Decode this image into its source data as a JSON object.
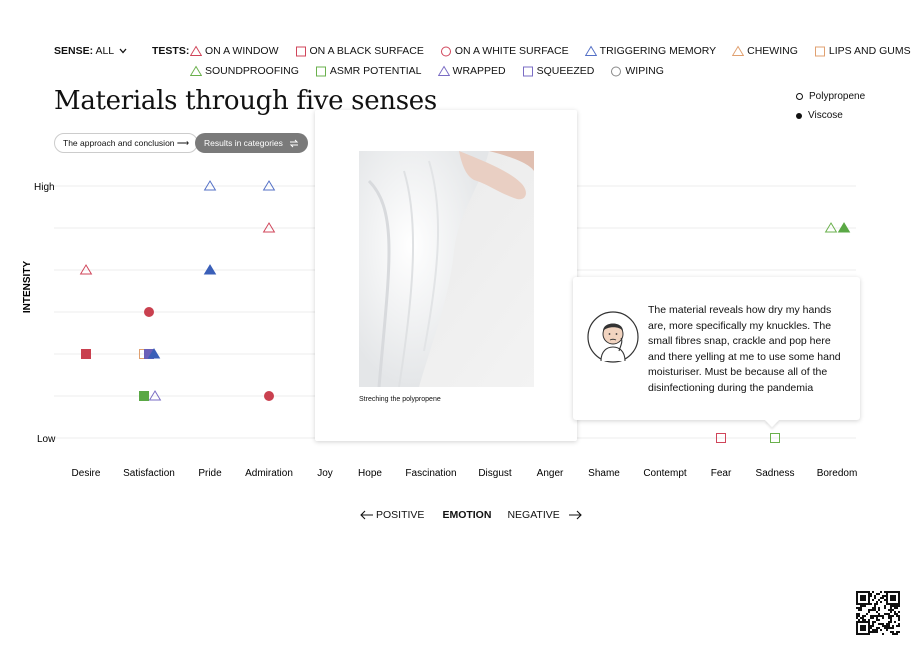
{
  "filters": {
    "sense_label": "SENSE:",
    "sense_value": "ALL",
    "tests_label": "TESTS:",
    "tests_row1": [
      {
        "label": "ON A WINDOW",
        "shape": "triangle",
        "color": "#d0455a"
      },
      {
        "label": "ON A BLACK SURFACE",
        "shape": "square",
        "color": "#d0455a"
      },
      {
        "label": "ON A WHITE SURFACE",
        "shape": "circle",
        "color": "#d0455a"
      },
      {
        "label": "TRIGGERING MEMORY",
        "shape": "triangle",
        "color": "#5470c6"
      },
      {
        "label": "CHEWING",
        "shape": "triangle",
        "color": "#e0a070"
      },
      {
        "label": "LIPS AND GUMS",
        "shape": "square",
        "color": "#e0a070"
      }
    ],
    "tests_row2": [
      {
        "label": "SOUNDPROOFING",
        "shape": "triangle",
        "color": "#6ab04c"
      },
      {
        "label": "ASMR POTENTIAL",
        "shape": "square",
        "color": "#6ab04c"
      },
      {
        "label": "WRAPPED",
        "shape": "triangle",
        "color": "#7a6cc4"
      },
      {
        "label": "SQUEEZED",
        "shape": "square",
        "color": "#7a6cc4"
      },
      {
        "label": "WIPING",
        "shape": "circle",
        "color": "#888888"
      }
    ]
  },
  "title": "Materials through five senses",
  "buttons": {
    "approach": "The approach and conclusion ⟶",
    "results": "Results in categories"
  },
  "materials": [
    {
      "label": "Polypropene",
      "filled": false
    },
    {
      "label": "Viscose",
      "filled": true
    }
  ],
  "chart_data": {
    "type": "scatter",
    "ylabel": "INTENSITY",
    "y_ticks": [
      "High",
      "Low"
    ],
    "categories": [
      "Desire",
      "Satisfaction",
      "Pride",
      "Admiration",
      "Joy",
      "Hope",
      "Fascination",
      "Disgust",
      "Anger",
      "Shame",
      "Contempt",
      "Fear",
      "Sadness",
      "Boredom"
    ],
    "levels": 7,
    "points": [
      {
        "cat": "Pride",
        "level": 7,
        "shape": "triangle",
        "color": "#5470c6",
        "filled": false
      },
      {
        "cat": "Admiration",
        "level": 7,
        "shape": "triangle",
        "color": "#5470c6",
        "filled": false
      },
      {
        "cat": "Admiration",
        "level": 6,
        "shape": "triangle",
        "color": "#d0455a",
        "filled": false
      },
      {
        "cat": "Desire",
        "level": 5,
        "shape": "triangle",
        "color": "#d0455a",
        "filled": false
      },
      {
        "cat": "Pride",
        "level": 5,
        "shape": "triangle",
        "color": "#3a5fb8",
        "filled": true
      },
      {
        "cat": "Satisfaction",
        "level": 4,
        "shape": "circle",
        "color": "#c9404f",
        "filled": true
      },
      {
        "cat": "Desire",
        "level": 3,
        "shape": "square",
        "color": "#c9404f",
        "filled": true
      },
      {
        "cat": "Satisfaction",
        "level": 3,
        "shape": "square",
        "color": "#e0a070",
        "filled": false,
        "dx": -5
      },
      {
        "cat": "Satisfaction",
        "level": 3,
        "shape": "square",
        "color": "#6a5fb8",
        "filled": true
      },
      {
        "cat": "Satisfaction",
        "level": 3,
        "shape": "triangle",
        "color": "#3a5fb8",
        "filled": true,
        "dx": 5
      },
      {
        "cat": "Satisfaction",
        "level": 2,
        "shape": "square",
        "color": "#5aa845",
        "filled": true,
        "dx": -5
      },
      {
        "cat": "Satisfaction",
        "level": 2,
        "shape": "triangle",
        "color": "#7a6cc4",
        "filled": false,
        "dx": 6
      },
      {
        "cat": "Admiration",
        "level": 2,
        "shape": "circle",
        "color": "#c9404f",
        "filled": true
      },
      {
        "cat": "Fear",
        "level": 1,
        "shape": "square",
        "color": "#d0455a",
        "filled": false
      },
      {
        "cat": "Sadness",
        "level": 1,
        "shape": "square",
        "color": "#6ab04c",
        "filled": false
      },
      {
        "cat": "Boredom",
        "level": 6,
        "shape": "triangle",
        "color": "#6ab04c",
        "filled": false,
        "dx": -6
      },
      {
        "cat": "Boredom",
        "level": 6,
        "shape": "triangle",
        "color": "#5aa845",
        "filled": true,
        "dx": 7
      }
    ]
  },
  "axis_direction": {
    "positive": "POSITIVE",
    "center": "EMOTION",
    "negative": "NEGATIVE"
  },
  "popup": {
    "caption": "Streching the polypropene"
  },
  "quote": {
    "text": "The material reveals how dry my hands are, more specifically my knuckles. The small fibres snap, crackle and pop here and there yelling at me to use some hand moisturiser. Must be because all of the disinfectioning during the pandemia"
  }
}
